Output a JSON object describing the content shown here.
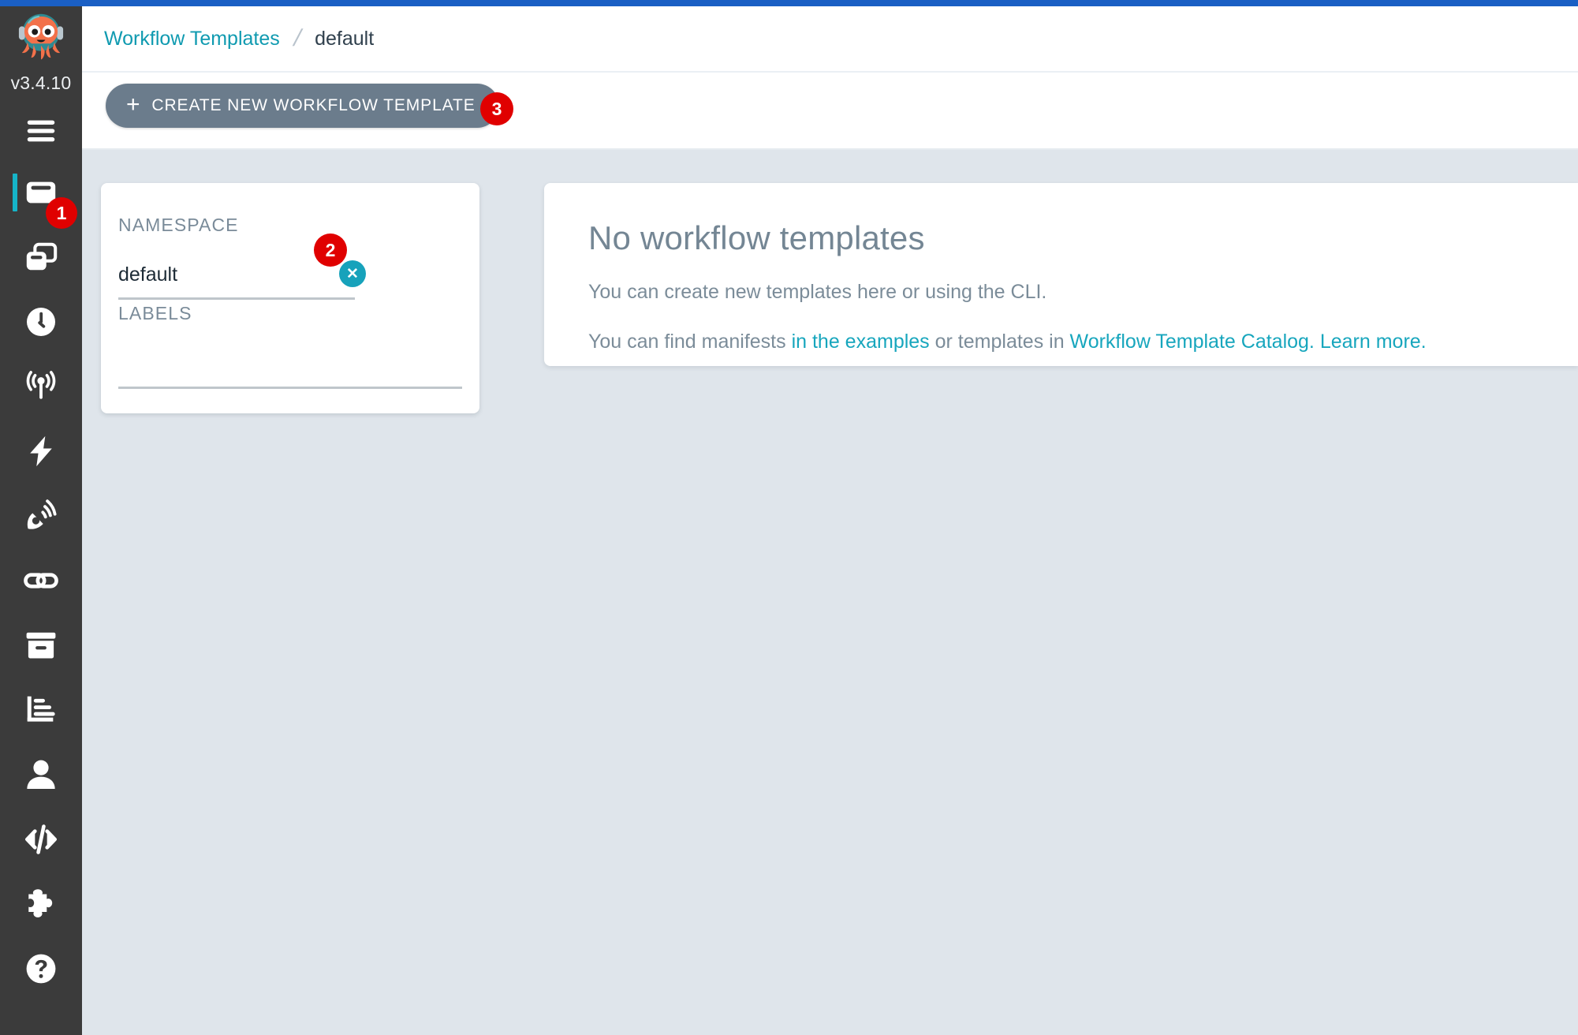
{
  "app": {
    "version": "v3.4.10",
    "accent_top_bar_color": "#1a5fc4",
    "sidebar_bg": "#3b3b3b",
    "active_indicator_color": "#16b4c8",
    "link_color": "#17a6bd",
    "marker_color": "#e00000"
  },
  "sidebar": {
    "logo_name": "argo-octopus-logo",
    "items": [
      {
        "name": "menu-toggle",
        "icon": "hamburger-icon",
        "active": false
      },
      {
        "name": "workflows",
        "icon": "workflow-card-icon",
        "active": true
      },
      {
        "name": "workflow-templates",
        "icon": "workflow-templates-icon",
        "active": false
      },
      {
        "name": "cron-workflows",
        "icon": "clock-icon",
        "active": false
      },
      {
        "name": "event-flow",
        "icon": "antenna-broadcast-icon",
        "active": false
      },
      {
        "name": "sensors",
        "icon": "lightning-bolt-icon",
        "active": false
      },
      {
        "name": "event-sources",
        "icon": "satellite-dish-icon",
        "active": false
      },
      {
        "name": "pipelines",
        "icon": "link-chain-icon",
        "active": false
      },
      {
        "name": "archived-workflows",
        "icon": "archive-box-icon",
        "active": false
      },
      {
        "name": "reports",
        "icon": "bar-chart-icon",
        "active": false
      },
      {
        "name": "user",
        "icon": "user-icon",
        "active": false
      },
      {
        "name": "api-docs",
        "icon": "code-brackets-icon",
        "active": false
      },
      {
        "name": "plugins",
        "icon": "puzzle-piece-icon",
        "active": false
      },
      {
        "name": "help",
        "icon": "question-circle-icon",
        "active": false
      }
    ]
  },
  "breadcrumb": {
    "root_label": "Workflow Templates",
    "separator": "/",
    "current_label": "default"
  },
  "toolbar": {
    "create_label": "CREATE NEW WORKFLOW TEMPLATE",
    "create_plus_icon": "plus-icon"
  },
  "filters": {
    "namespace_label": "NAMESPACE",
    "namespace_value": "default",
    "namespace_placeholder": "",
    "clear_icon": "close-x-icon",
    "labels_label": "LABELS",
    "labels_value": "",
    "labels_placeholder": ""
  },
  "empty_state": {
    "title": "No workflow templates",
    "line1": "You can create new templates here or using the CLI.",
    "line2_prefix": "You can find manifests ",
    "line2_link1": "in the examples",
    "line2_middle": " or templates in ",
    "line2_link2": "Workflow Template Catalog.",
    "line2_space": " ",
    "line2_link3": "Learn more."
  },
  "markers": [
    {
      "id": "marker-1",
      "label": "1"
    },
    {
      "id": "marker-2",
      "label": "2"
    },
    {
      "id": "marker-3",
      "label": "3"
    }
  ]
}
